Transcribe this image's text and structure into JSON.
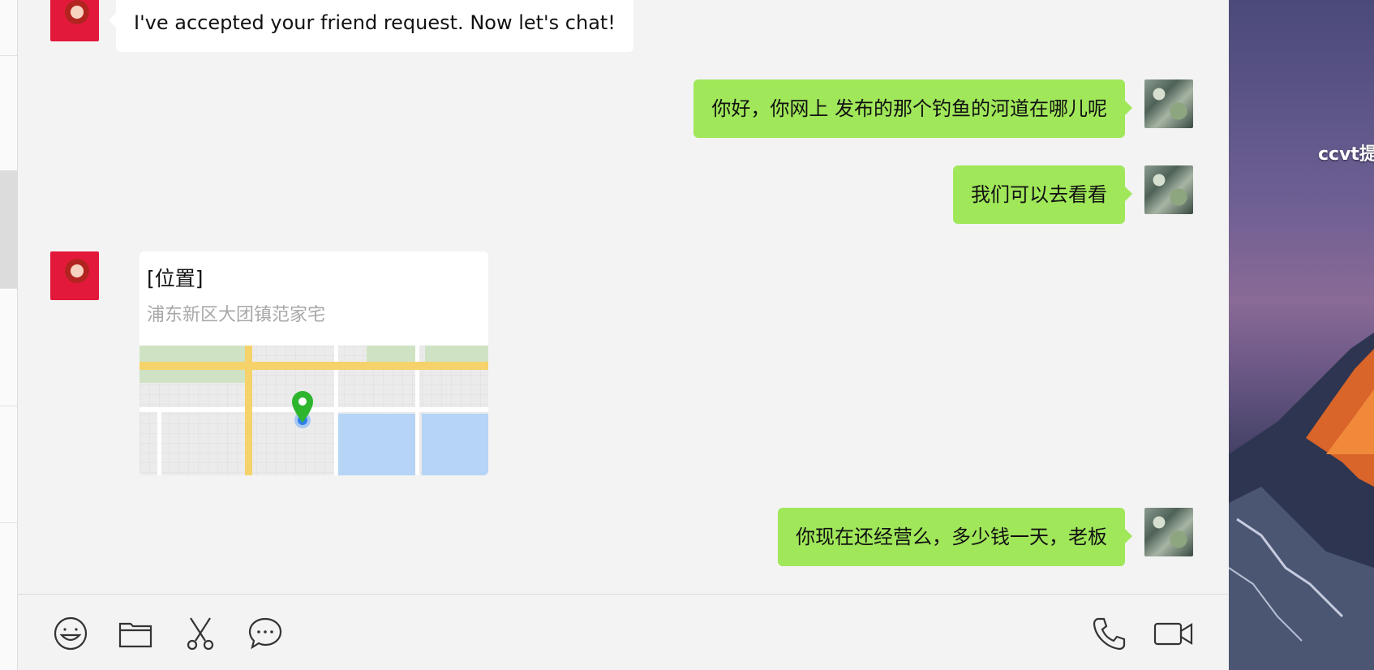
{
  "messages": [
    {
      "side": "left",
      "type": "text",
      "text": "I've accepted your friend request. Now let's chat!"
    },
    {
      "side": "right",
      "type": "text",
      "text": "你好，你网上 发布的那个钓鱼的河道在哪儿呢"
    },
    {
      "side": "right",
      "type": "text",
      "text": "我们可以去看看"
    },
    {
      "side": "left",
      "type": "location",
      "title": "[位置]",
      "address": "浦东新区大团镇范家宅"
    },
    {
      "side": "right",
      "type": "text",
      "text": "你现在还经营么，多少钱一天，老板"
    }
  ],
  "toolbar": {
    "left_icons": [
      "emoji-icon",
      "folder-icon",
      "scissors-icon",
      "chat-bubble-icon"
    ],
    "right_icons": [
      "phone-icon",
      "video-call-icon"
    ]
  },
  "desktop": {
    "label": "ccvt提"
  },
  "colors": {
    "sent_bubble": "#a0e75a",
    "received_bubble": "#ffffff",
    "chat_background": "#f3f3f3",
    "map_pin": "#2eb52e",
    "map_dot": "#2f80ed"
  }
}
